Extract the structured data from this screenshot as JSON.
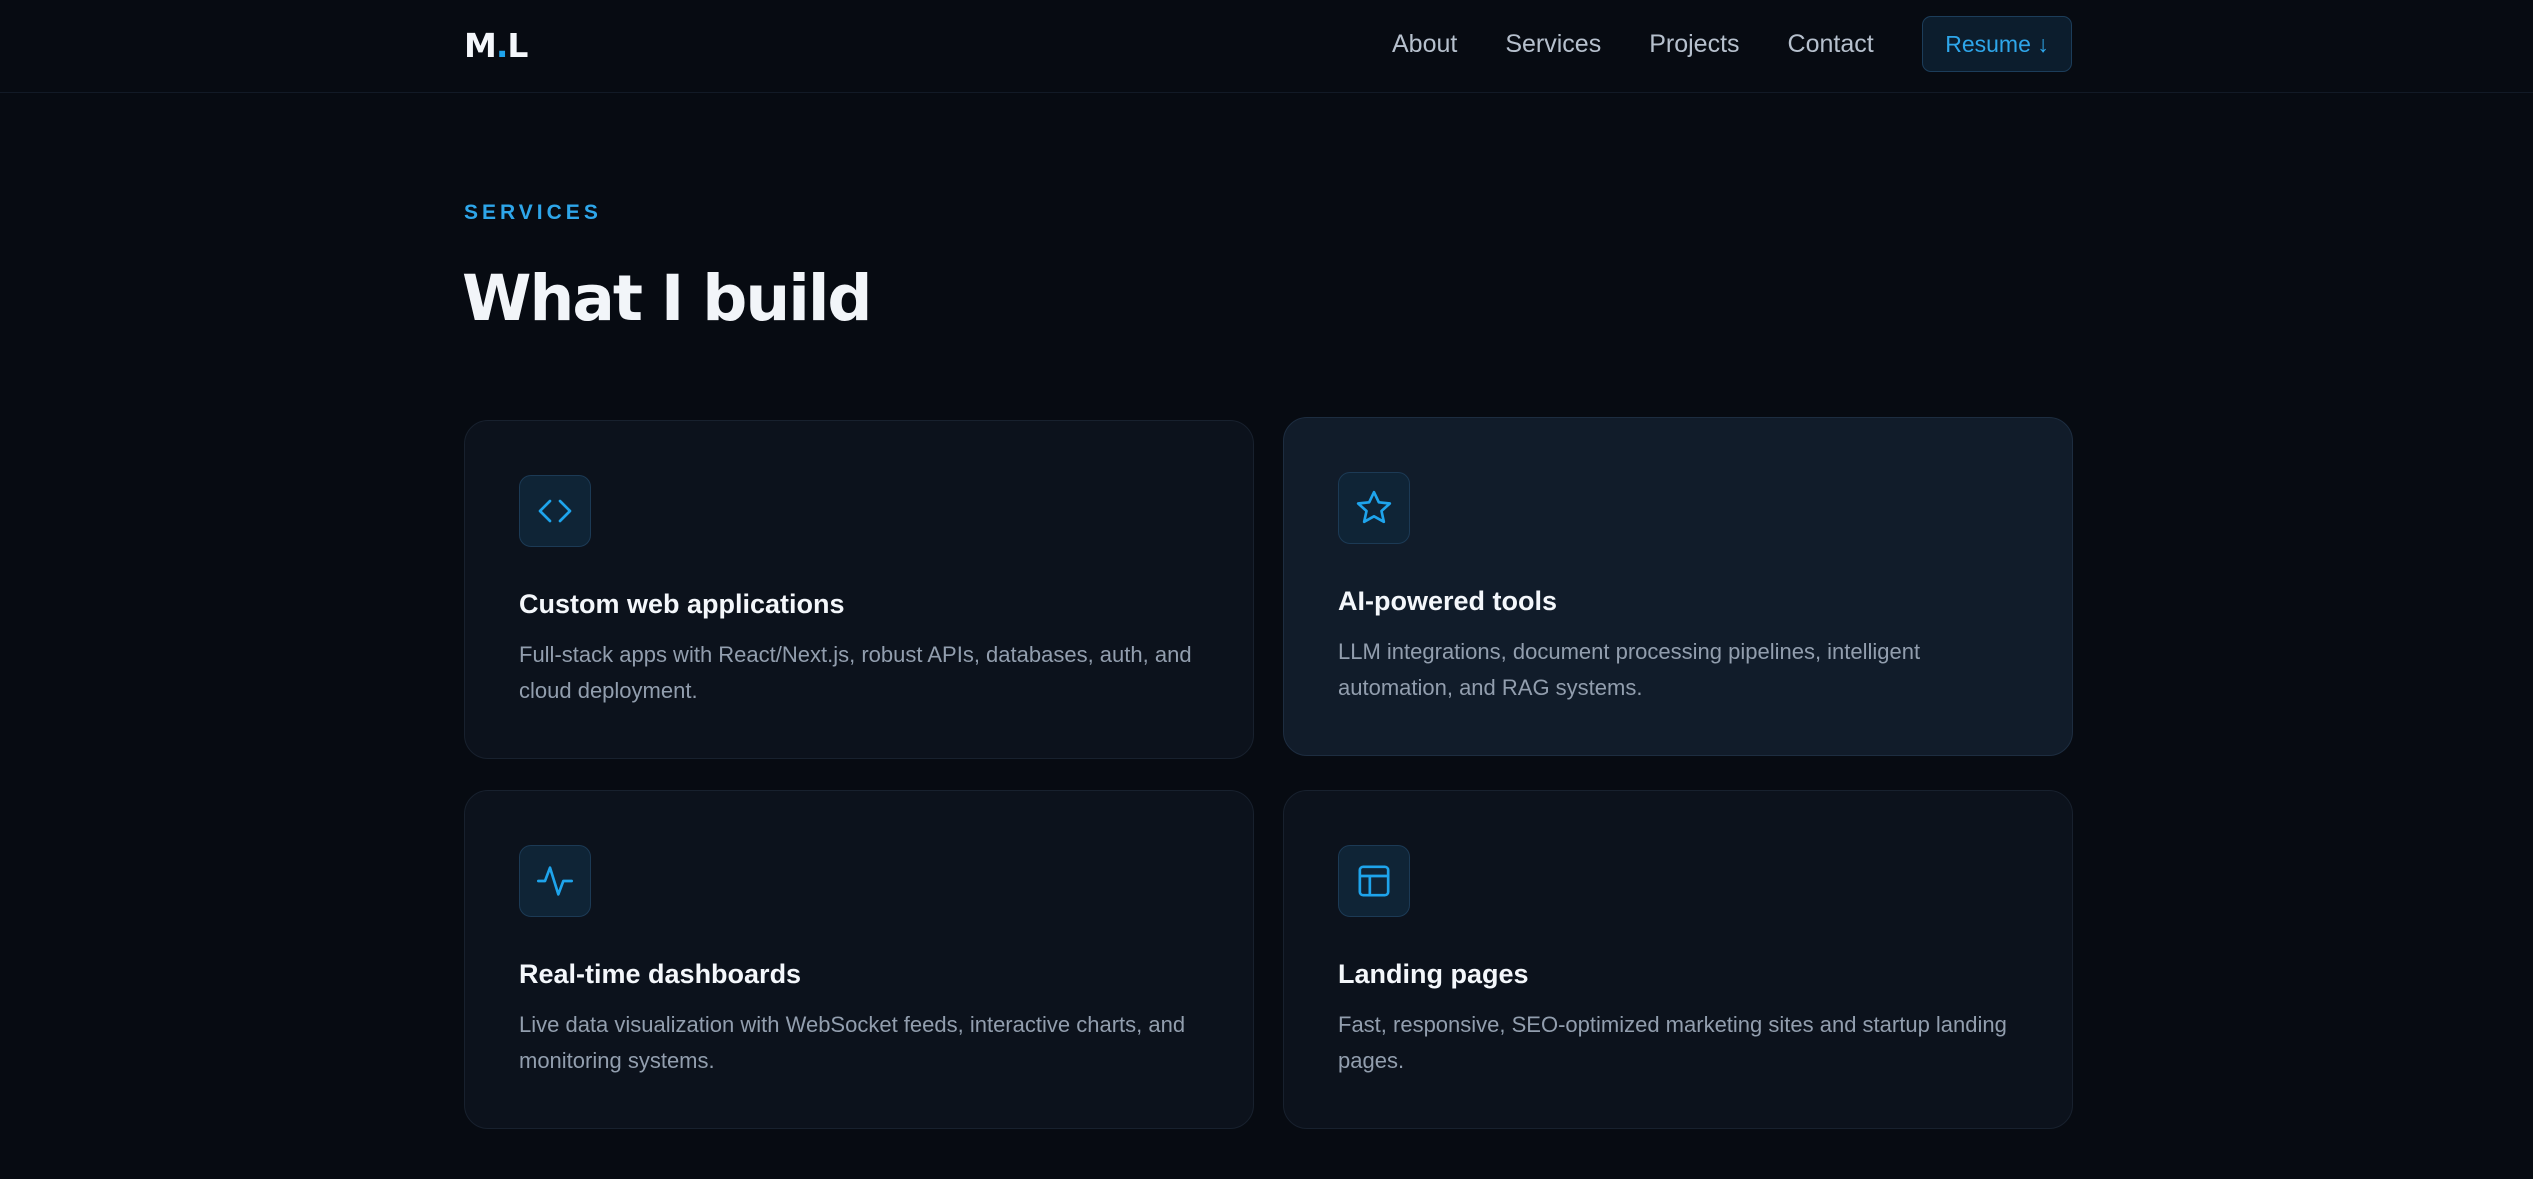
{
  "nav": {
    "logo_left": "M",
    "logo_dot": ".",
    "logo_right": "L",
    "links": [
      "About",
      "Services",
      "Projects",
      "Contact"
    ],
    "resume_label": "Resume ↓"
  },
  "section": {
    "eyebrow": "SERVICES",
    "heading": "What I build"
  },
  "services": [
    {
      "title": "Custom web applications",
      "description": "Full-stack apps with React/Next.js, robust APIs, databases, auth, and cloud deployment.",
      "icon": "code-icon"
    },
    {
      "title": "AI-powered tools",
      "description": "LLM integrations, document processing pipelines, intelligent automation, and RAG systems.",
      "icon": "star-icon"
    },
    {
      "title": "Real-time dashboards",
      "description": "Live data visualization with WebSocket feeds, interactive charts, and monitoring systems.",
      "icon": "activity-icon"
    },
    {
      "title": "Landing pages",
      "description": "Fast, responsive, SEO-optimized marketing sites and startup landing pages.",
      "icon": "layout-icon"
    }
  ],
  "colors": {
    "background": "#070b12",
    "accent": "#1ea4ec",
    "card": "#0c121c",
    "card_highlight": "#111c2a"
  }
}
